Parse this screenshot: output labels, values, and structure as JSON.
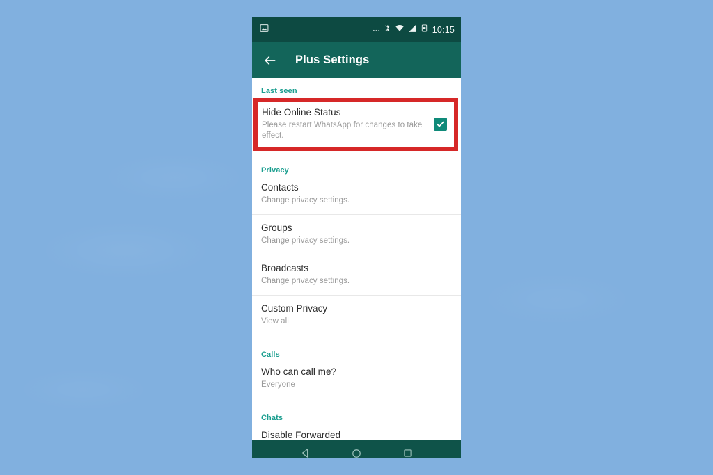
{
  "status_bar": {
    "notification_icon": "image-notification-icon",
    "icons": [
      "ellipsis-icon",
      "bluetooth-icon",
      "wifi-icon",
      "cellular-signal-icon",
      "battery-icon"
    ],
    "time": "10:15"
  },
  "app_bar": {
    "back_icon": "back-arrow-icon",
    "title": "Plus Settings"
  },
  "sections": [
    {
      "header": "Last seen",
      "rows": [
        {
          "title": "Hide Online Status",
          "subtitle": "Please restart WhatsApp for changes to take effect.",
          "checkbox_checked": true,
          "highlighted": true
        }
      ]
    },
    {
      "header": "Privacy",
      "rows": [
        {
          "title": "Contacts",
          "subtitle": "Change privacy settings."
        },
        {
          "title": "Groups",
          "subtitle": "Change privacy settings."
        },
        {
          "title": "Broadcasts",
          "subtitle": "Change privacy settings."
        },
        {
          "title": "Custom Privacy",
          "subtitle": "View all"
        }
      ]
    },
    {
      "header": "Calls",
      "rows": [
        {
          "title": "Who can call me?",
          "subtitle": "Everyone"
        }
      ]
    },
    {
      "header": "Chats",
      "rows": [
        {
          "title": "Disable Forwarded",
          "subtitle": ""
        }
      ]
    }
  ],
  "nav_bar": {
    "back": "nav-back-icon",
    "home": "nav-home-icon",
    "recents": "nav-recents-icon"
  },
  "colors": {
    "backdrop": "#81b0df",
    "status_bar": "#0d4a42",
    "app_bar": "#13655a",
    "nav_bar": "#0f5349",
    "section_header": "#1a9e8f",
    "checkbox": "#0f8a79",
    "highlight": "#d62828"
  }
}
